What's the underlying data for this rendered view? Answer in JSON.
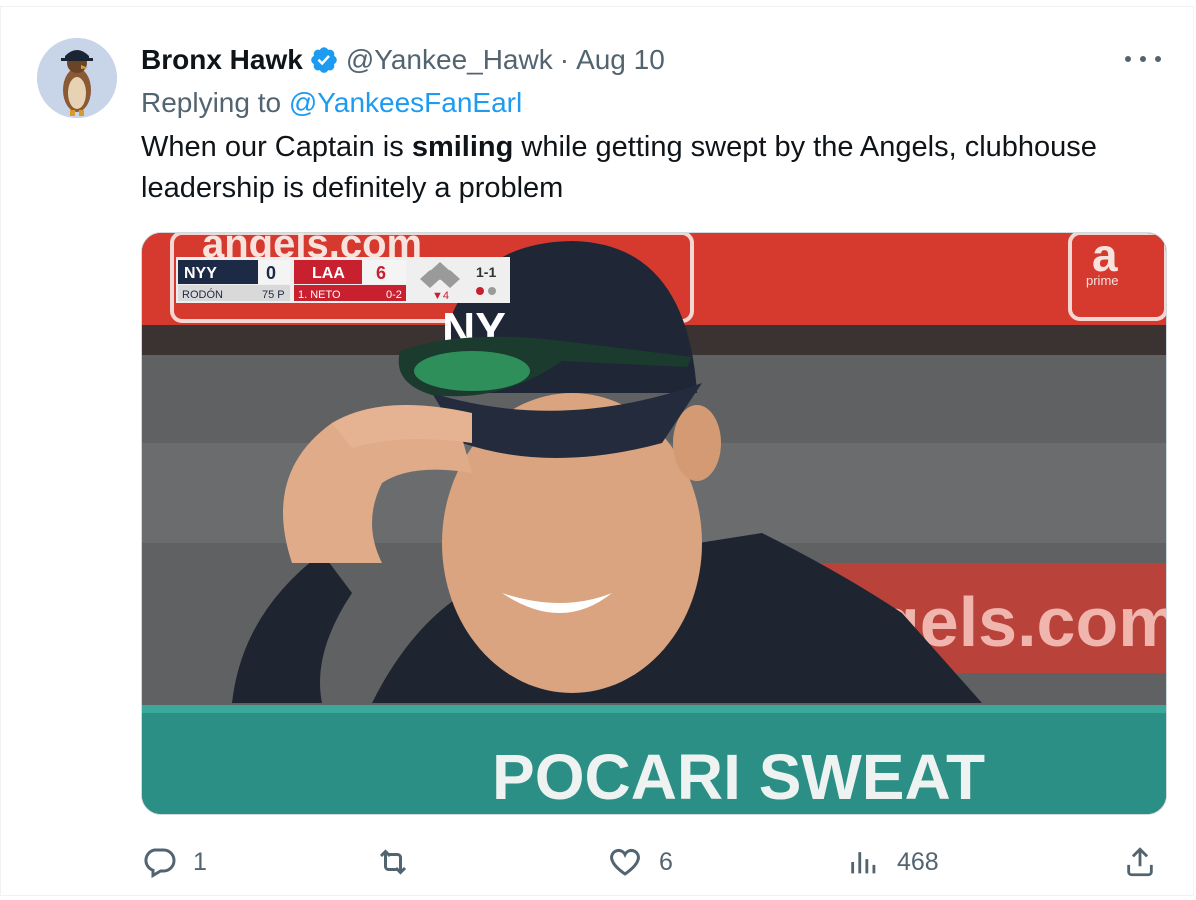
{
  "author": {
    "name": "Bronx Hawk",
    "handle": "@Yankee_Hawk",
    "separator": "·",
    "date": "Aug 10",
    "avatar_icon": "hawk-avatar",
    "verified_icon": "verified-badge-icon"
  },
  "reply": {
    "prefix": "Replying to ",
    "mention": "@YankeesFanEarl"
  },
  "tweet": {
    "text_before": "When our Captain is ",
    "text_bold": "smiling",
    "text_after_line1": " while getting swept by the Angels, clubhouse",
    "text_line2": "leadership is definitely a problem"
  },
  "media": {
    "description_icon": "photo",
    "scoreboard": {
      "away_team": "NYY",
      "away_score": "0",
      "home_team": "LAA",
      "home_score": "6",
      "pitcher": "RODÓN",
      "pitch_count": "75 P",
      "batter": "1. NETO",
      "batter_line": "0-2",
      "inning": "▼4",
      "count": "1-1"
    },
    "sign_top_left": "angels.com",
    "sign_top_right": "a",
    "sign_prime": "prime",
    "sign_right": "gels.com",
    "banner": "POCARI SWEAT"
  },
  "actions": {
    "reply_count": "1",
    "retweet_count": "",
    "like_count": "6",
    "views_count": "468"
  },
  "colors": {
    "link": "#1d9bf0",
    "secondary": "#536471",
    "verified": "#1d9bf0"
  }
}
